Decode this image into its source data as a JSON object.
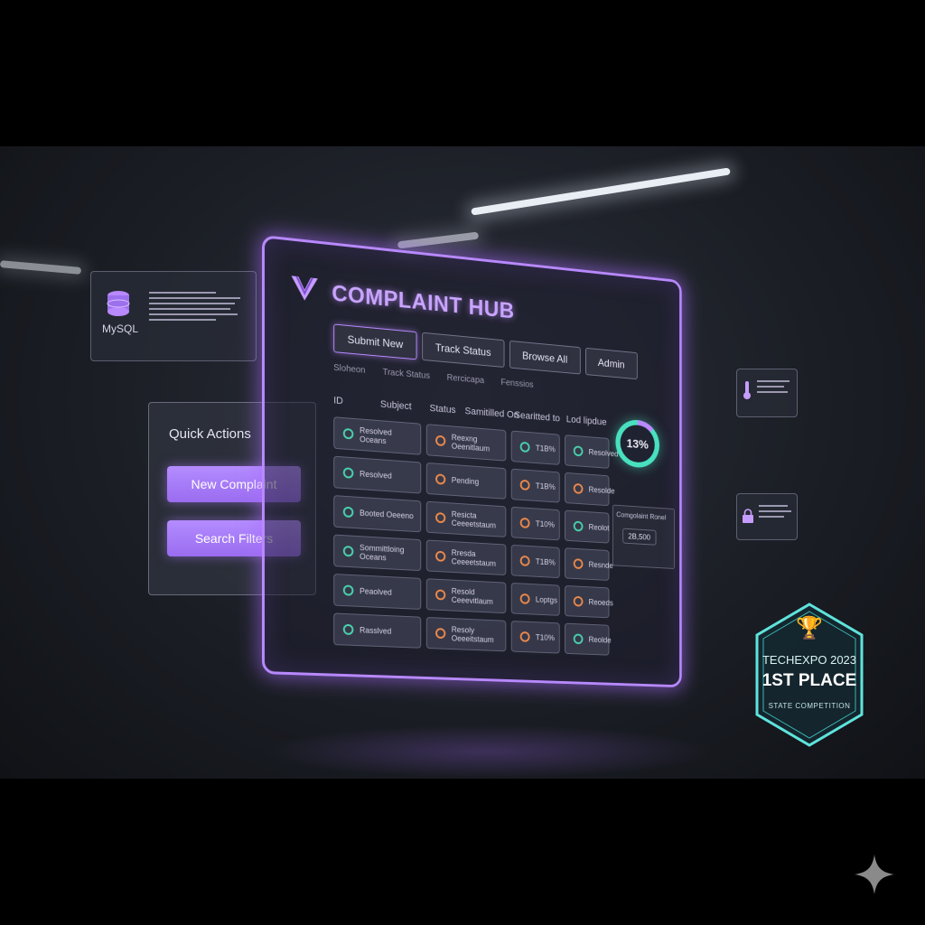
{
  "app": {
    "title": "COMPLAINT HUB"
  },
  "tabs": [
    {
      "label": "Submit New",
      "active": true
    },
    {
      "label": "Track Status",
      "active": false
    },
    {
      "label": "Browse All",
      "active": false
    },
    {
      "label": "Admin",
      "active": false
    }
  ],
  "subtabs": [
    "Sloheon",
    "Track Status",
    "Rercicapa",
    "Fenssios"
  ],
  "table": {
    "columns": [
      "ID",
      "Subject",
      "Status",
      "Samitilled On",
      "Searitted to",
      "Lod lipdue"
    ],
    "rows": [
      {
        "col1": "Resolved Oceans",
        "col1_icon": "ok",
        "col2": "Reexng Oeenitlaum",
        "col3": "T1B%",
        "col4": "Resolved"
      },
      {
        "col1": "Resolved",
        "col1_icon": "ok",
        "col2": "Pending",
        "col3": "T1B%",
        "col4": "Resolde"
      },
      {
        "col1": "Booted Oeeeno",
        "col1_icon": "ok",
        "col2": "Resicta Ceeeetstaum",
        "col3": "T10%",
        "col4": "Reolot"
      },
      {
        "col1": "Sommittloing Oceans",
        "col1_icon": "ok",
        "col2": "Rresda Ceeeetstaum",
        "col3": "T1B%",
        "col4": "Resnde"
      },
      {
        "col1": "Peaolved",
        "col1_icon": "ok",
        "col2": "Resold Ceeevitlaum",
        "col3": "Loptgs",
        "col4": "Reoeds"
      },
      {
        "col1": "Rasslved",
        "col1_icon": "ok",
        "col2": "Resoly Oeeeitstaum",
        "col3": "T10%",
        "col4": "Reolde"
      }
    ]
  },
  "stats": {
    "donut_percent": 13,
    "donut_label": "13%",
    "box_label": "Comgolaint Ronel",
    "box_value": "2B,500"
  },
  "quick_actions": {
    "title": "Quick Actions",
    "new_label": "New Complaint",
    "search_label": "Search Filters"
  },
  "db_card": {
    "label": "MySQL"
  },
  "badge": {
    "line1": "TECHEXPO 2023",
    "line2": "1ST PLACE",
    "line3": "STATE COMPETITION"
  },
  "colors": {
    "accent": "#b889ff",
    "teal": "#49e0c0",
    "warn": "#ef8a4a"
  }
}
